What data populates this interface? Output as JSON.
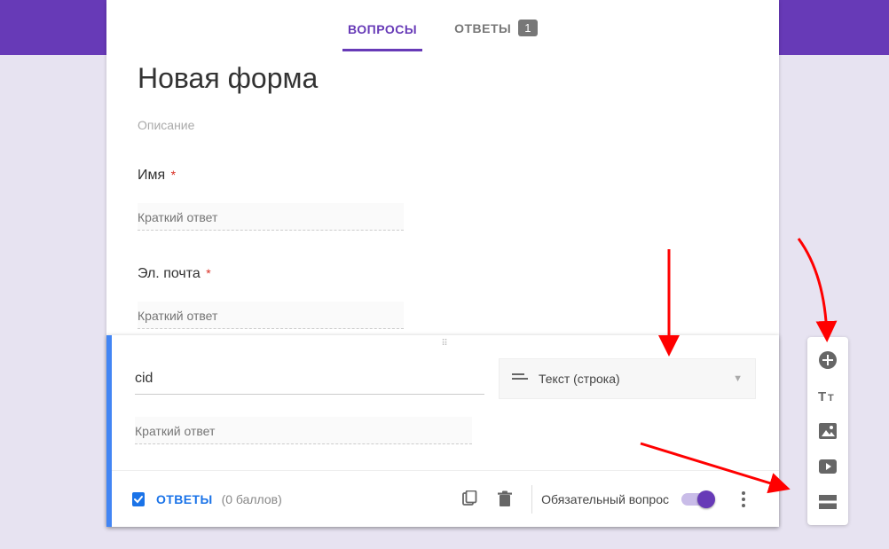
{
  "tabs": {
    "questions": "ВОПРОСЫ",
    "answers": "ОТВЕТЫ",
    "answersBadge": "1"
  },
  "header": {
    "title": "Новая форма",
    "desc": "Описание"
  },
  "questions": [
    {
      "label": "Имя",
      "required": true,
      "hint": "Краткий ответ"
    },
    {
      "label": "Эл. почта",
      "required": true,
      "hint": "Краткий ответ"
    }
  ],
  "activeQuestion": {
    "title": "cid",
    "type": "Текст (строка)",
    "hint": "Краткий ответ",
    "answerKeyLabel": "ОТВЕТЫ",
    "pointsText": "(0 баллов)",
    "requiredLabel": "Обязательный вопрос",
    "requiredOn": true
  },
  "sideTools": {
    "add": "add-question",
    "title": "add-title",
    "image": "add-image",
    "video": "add-video",
    "section": "add-section"
  }
}
